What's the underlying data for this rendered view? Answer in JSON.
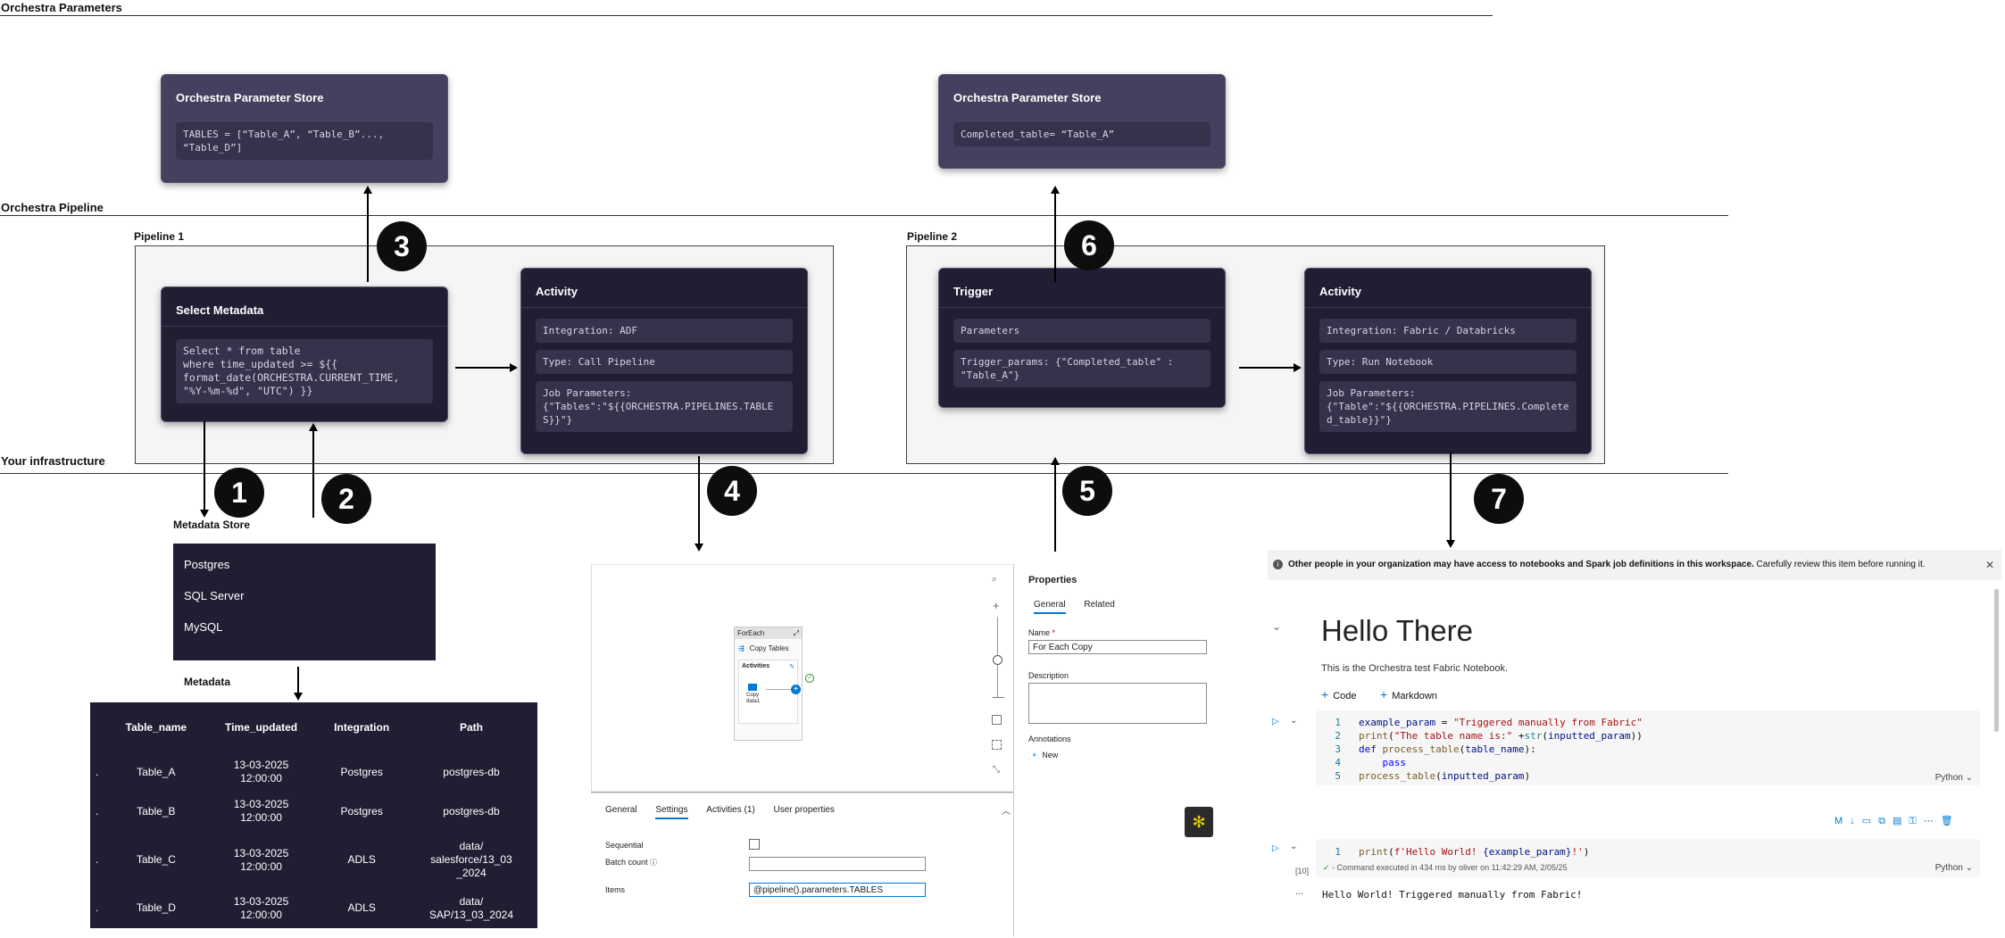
{
  "sections": {
    "params": "Orchestra Parameters",
    "pipeline": "Orchestra Pipeline",
    "infra": "Your infrastructure"
  },
  "param_store_1": {
    "title": "Orchestra Parameter Store",
    "code": "TABLES = [“Table_A”, “Table_B”..., “Table_D”]"
  },
  "param_store_2": {
    "title": "Orchestra Parameter Store",
    "code": "Completed_table= “Table_A”"
  },
  "pipeline1": {
    "label": "Pipeline 1",
    "select": {
      "title": "Select Metadata",
      "code": "Select * from table\nwhere time_updated >= ${{\nformat_date(ORCHESTRA.CURRENT_TIME,\n\"%Y-%m-%d\", \"UTC\") }}"
    },
    "activity": {
      "title": "Activity",
      "integration": "Integration: ADF",
      "type": "Type: Call Pipeline",
      "params": "Job Parameters:\n{\"Tables\":\"${{ORCHESTRA.PIPELINES.TABLES}}\"}"
    }
  },
  "pipeline2": {
    "label": "Pipeline 2",
    "trigger": {
      "title": "Trigger",
      "params": "Parameters",
      "trigger_params": "Trigger_params: {\"Completed_table\" :\n\"Table_A\"}"
    },
    "activity": {
      "title": "Activity",
      "integration": "Integration: Fabric / Databricks",
      "type": "Type: Run Notebook",
      "params": "Job Parameters:\n{\"Table\":\"${{ORCHESTRA.PIPELINES.Completed_table}}\"}"
    }
  },
  "steps": [
    "1",
    "2",
    "3",
    "4",
    "5",
    "6",
    "7"
  ],
  "metadata_store": {
    "title": "Metadata Store",
    "items": [
      "Postgres",
      "SQL Server",
      "MySQL"
    ]
  },
  "metadata": {
    "title": "Metadata",
    "columns": [
      "Table_name",
      "Time_updated",
      "Integration",
      "Path"
    ],
    "rows": [
      {
        "dot": ".",
        "name": "Table_A",
        "time": "13-03-2025\n12:00:00",
        "integration": "Postgres",
        "path": "postgres-db"
      },
      {
        "dot": ".",
        "name": "Table_B",
        "time": "13-03-2025\n12:00:00",
        "integration": "Postgres",
        "path": "postgres-db"
      },
      {
        "dot": ".",
        "name": "Table_C",
        "time": "13-03-2025\n12:00:00",
        "integration": "ADLS",
        "path": "data/\nsalesforce/13_03\n_2024"
      },
      {
        "dot": ".",
        "name": "Table_D",
        "time": "13-03-2025\n12:00:00",
        "integration": "ADLS",
        "path": "data/\nSAP/13_03_2024"
      }
    ]
  },
  "adf": {
    "foreach": "ForEach",
    "copy_tables": "Copy Tables",
    "activities": "Activities",
    "copy_data": "Copy\ndata1",
    "properties": "Properties",
    "props_tabs": [
      "General",
      "Related"
    ],
    "name_label": "Name",
    "name_value": "For Each Copy",
    "description_label": "Description",
    "annotations_label": "Annotations",
    "new_label": "New",
    "bottom_tabs": [
      "General",
      "Settings",
      "Activities (1)",
      "User properties"
    ],
    "sequential_label": "Sequential",
    "batch_label": "Batch count",
    "items_label": "Items",
    "items_value": "@pipeline().parameters.TABLES"
  },
  "notebook": {
    "banner_bold": "Other people in your organization may have access to notebooks and Spark job definitions in this workspace.",
    "banner_rest": " Carefully review this item before running it.",
    "heading": "Hello There",
    "subtitle": "This is the Orchestra test Fabric Notebook.",
    "add_code": "Code",
    "add_markdown": "Markdown",
    "lang": "Python",
    "cell2_counter": "[10]",
    "cell2_status": "- Command executed in 434 ms by oliver on 11:42:29 AM, 2/05/25",
    "output": "Hello World! Triggered manually from Fabric!",
    "ellipsis": "..."
  }
}
